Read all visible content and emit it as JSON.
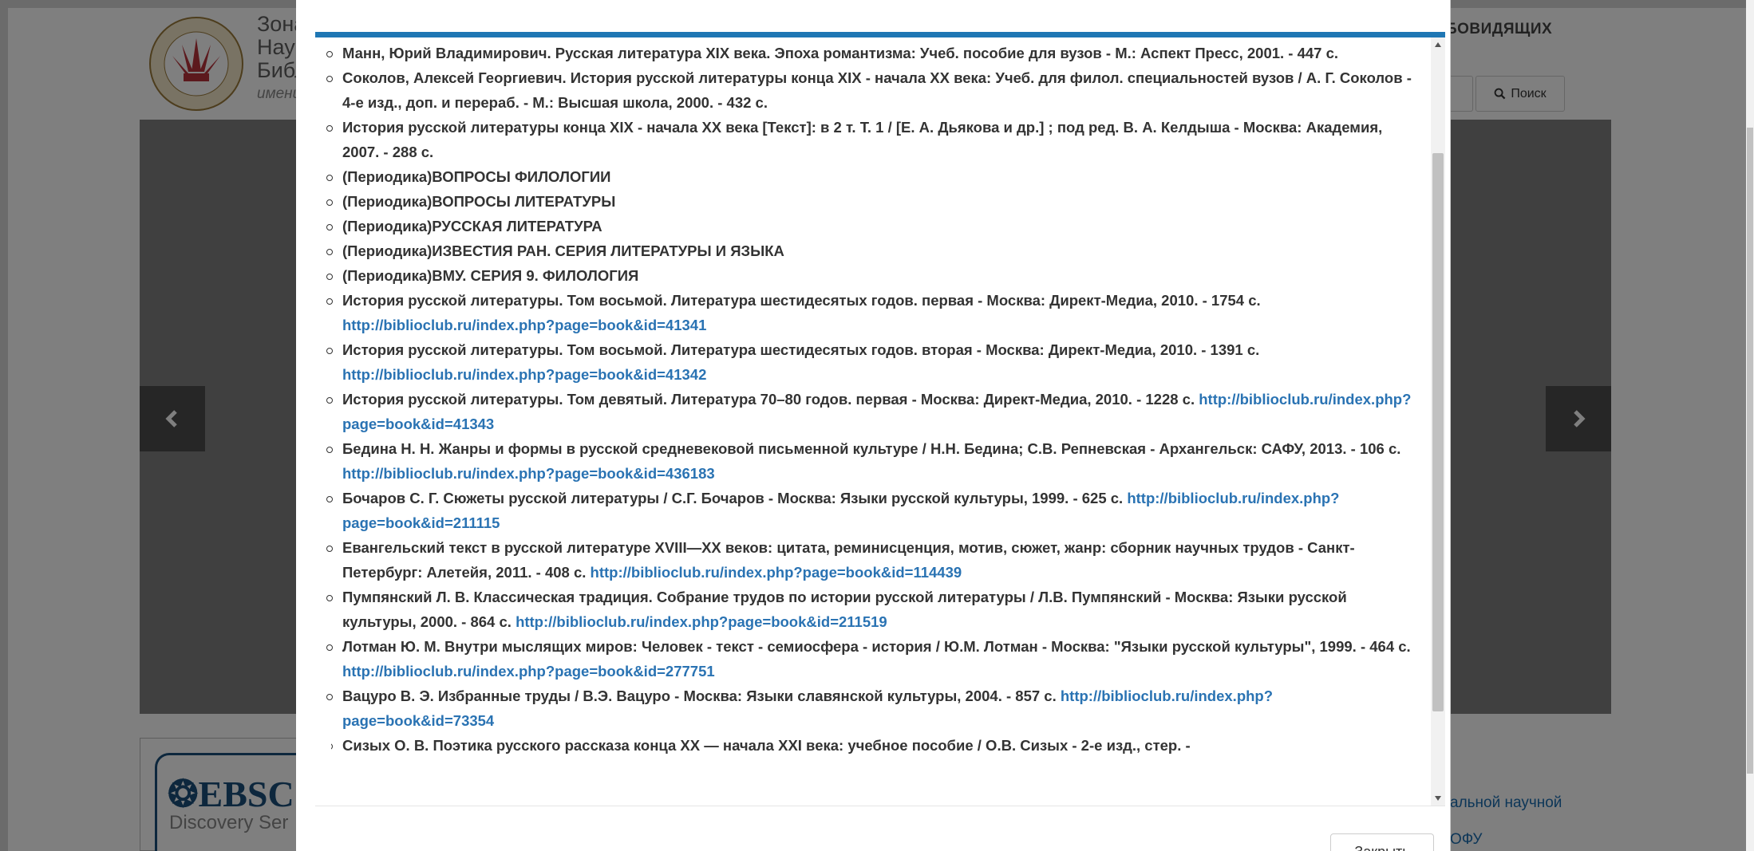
{
  "header": {
    "title_lines": [
      "Зональная",
      "Научная",
      "Библиотека",
      "имени"
    ],
    "vision_link": "СЛАБОВИДЯЩИХ",
    "vision_link_visible": "БОВИДЯЩИХ",
    "search_label": "Поиск"
  },
  "banner": {
    "ebsco_logo": "EBSCO",
    "ebsco_logo_visible": "EBSC",
    "ebsco_subtitle_visible": "Discovery Ser"
  },
  "footer_links": {
    "line1_visible": "альной научной",
    "line2_visible": "ОФУ"
  },
  "modal": {
    "close_label": "Закрыть",
    "items": [
      {
        "text": "Манн, Юрий Владимирович. Русская литература XIX века. Эпоха романтизма: Учеб. пособие для вузов - М.: Аспект Пресс, 2001. - 447 с.",
        "link": ""
      },
      {
        "text": "Соколов, Алексей Георгиевич. История русской литературы конца XIX - начала XX века: Учеб. для филол. специальностей вузов / А. Г. Соколов - 4-е изд., доп. и перераб. - М.: Высшая школа, 2000. - 432 с.",
        "link": ""
      },
      {
        "text": "История русской литературы конца XIX - начала XX века [Текст]: в 2 т. Т. 1 / [Е. А. Дьякова и др.] ; под ред. В. А. Келдыша - Москва: Академия, 2007. - 288 с.",
        "link": ""
      },
      {
        "text": "(Периодика)ВОПРОСЫ ФИЛОЛОГИИ",
        "link": ""
      },
      {
        "text": "(Периодика)ВОПРОСЫ ЛИТЕРАТУРЫ",
        "link": ""
      },
      {
        "text": "(Периодика)РУССКАЯ ЛИТЕРАТУРА",
        "link": ""
      },
      {
        "text": "(Периодика)ИЗВЕСТИЯ РАН. СЕРИЯ ЛИТЕРАТУРЫ И ЯЗЫКА",
        "link": ""
      },
      {
        "text": "(Периодика)ВМУ. СЕРИЯ 9. ФИЛОЛОГИЯ",
        "link": ""
      },
      {
        "text": "История русской литературы. Том восьмой. Литература шестидесятых годов. первая - Москва: Директ-Медиа, 2010. - 1754 с.",
        "link": "http://biblioclub.ru/index.php?page=book&id=41341"
      },
      {
        "text": "История русской литературы. Том восьмой. Литература шестидесятых годов. вторая - Москва: Директ-Медиа, 2010. - 1391 с.",
        "link": "http://biblioclub.ru/index.php?page=book&id=41342"
      },
      {
        "text": "История русской литературы. Том девятый. Литература 70–80 годов. первая - Москва: Директ-Медиа, 2010. - 1228 с.",
        "link": "http://biblioclub.ru/index.php?page=book&id=41343"
      },
      {
        "text": "Бедина Н. Н. Жанры и формы в русской средневековой письменной культуре / Н.Н. Бедина; С.В. Репневская - Архангельск: САФУ, 2013. - 106 с.",
        "link": "http://biblioclub.ru/index.php?page=book&id=436183"
      },
      {
        "text": "Бочаров С. Г. Сюжеты русской литературы / С.Г. Бочаров - Москва: Языки русской культуры, 1999. - 625 с.",
        "link": "http://biblioclub.ru/index.php?page=book&id=211115"
      },
      {
        "text": "Евангельский текст в русской литературе XVIII—XX веков: цитата, реминисценция, мотив, сюжет, жанр: сборник научных трудов - Санкт-Петербург: Алетейя, 2011. - 408 с.",
        "link": "http://biblioclub.ru/index.php?page=book&id=114439"
      },
      {
        "text": "Пумпянский Л. В. Классическая традиция. Собрание трудов по истории русской литературы / Л.В. Пумпянский - Москва: Языки русской культуры, 2000. - 864 с.",
        "link": "http://biblioclub.ru/index.php?page=book&id=211519"
      },
      {
        "text": "Лотман Ю. М. Внутри мыслящих миров: Человек - текст - семиосфера - история / Ю.М. Лотман - Москва: \"Языки русской культуры\", 1999. - 464 с.",
        "link": "http://biblioclub.ru/index.php?page=book&id=277751"
      },
      {
        "text": "Вацуро В. Э. Избранные труды / В.Э. Вацуро - Москва: Языки славянской культуры, 2004. - 857 с.",
        "link": "http://biblioclub.ru/index.php?page=book&id=73354"
      },
      {
        "text": "Сизых О. В. Поэтика русского рассказа конца XX — начала XXI века: учебное пособие / О.В. Сизых - 2-е изд., стер. -",
        "link": ""
      }
    ]
  }
}
